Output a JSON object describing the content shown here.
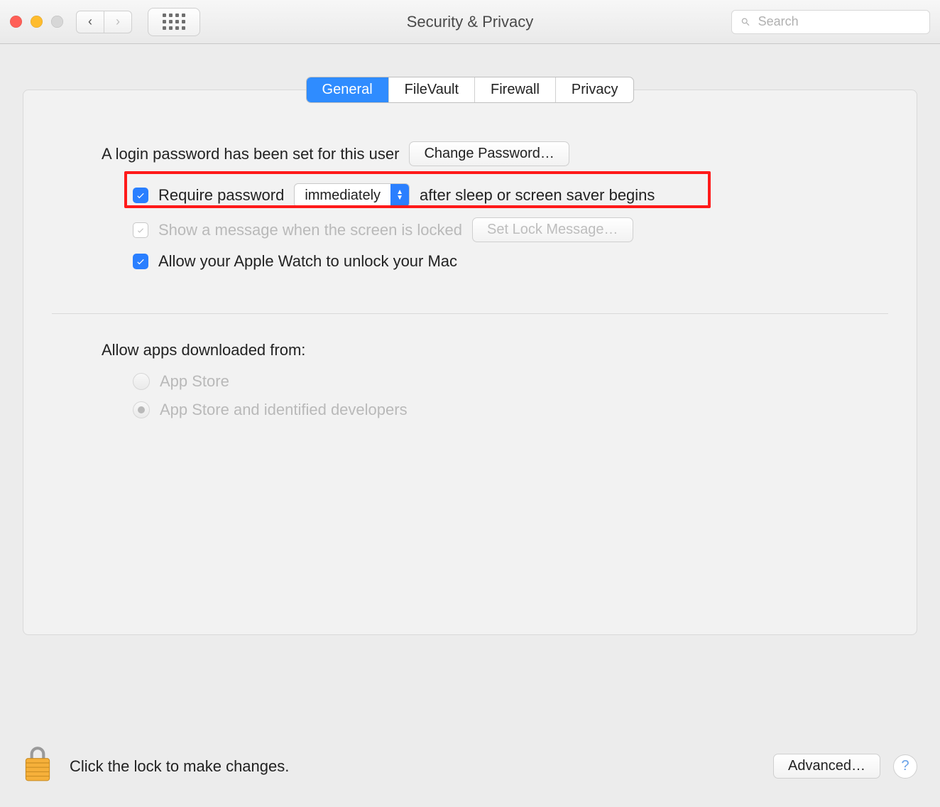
{
  "window": {
    "title": "Security & Privacy"
  },
  "search": {
    "placeholder": "Search"
  },
  "tabs": {
    "general": "General",
    "filevault": "FileVault",
    "firewall": "Firewall",
    "privacy": "Privacy",
    "active": "general"
  },
  "general": {
    "login_text": "A login password has been set for this user",
    "change_pw_btn": "Change Password…",
    "require_pw_label_pre": "Require password",
    "require_pw_popup": "immediately",
    "require_pw_label_post": "after sleep or screen saver begins",
    "show_msg_label": "Show a message when the screen is locked",
    "set_lock_msg_btn": "Set Lock Message…",
    "apple_watch_label": "Allow your Apple Watch to unlock your Mac",
    "allow_apps_heading": "Allow apps downloaded from:",
    "radio_app_store": "App Store",
    "radio_identified": "App Store and identified developers"
  },
  "footer": {
    "lock_text": "Click the lock to make changes.",
    "advanced_btn": "Advanced…",
    "help": "?"
  }
}
